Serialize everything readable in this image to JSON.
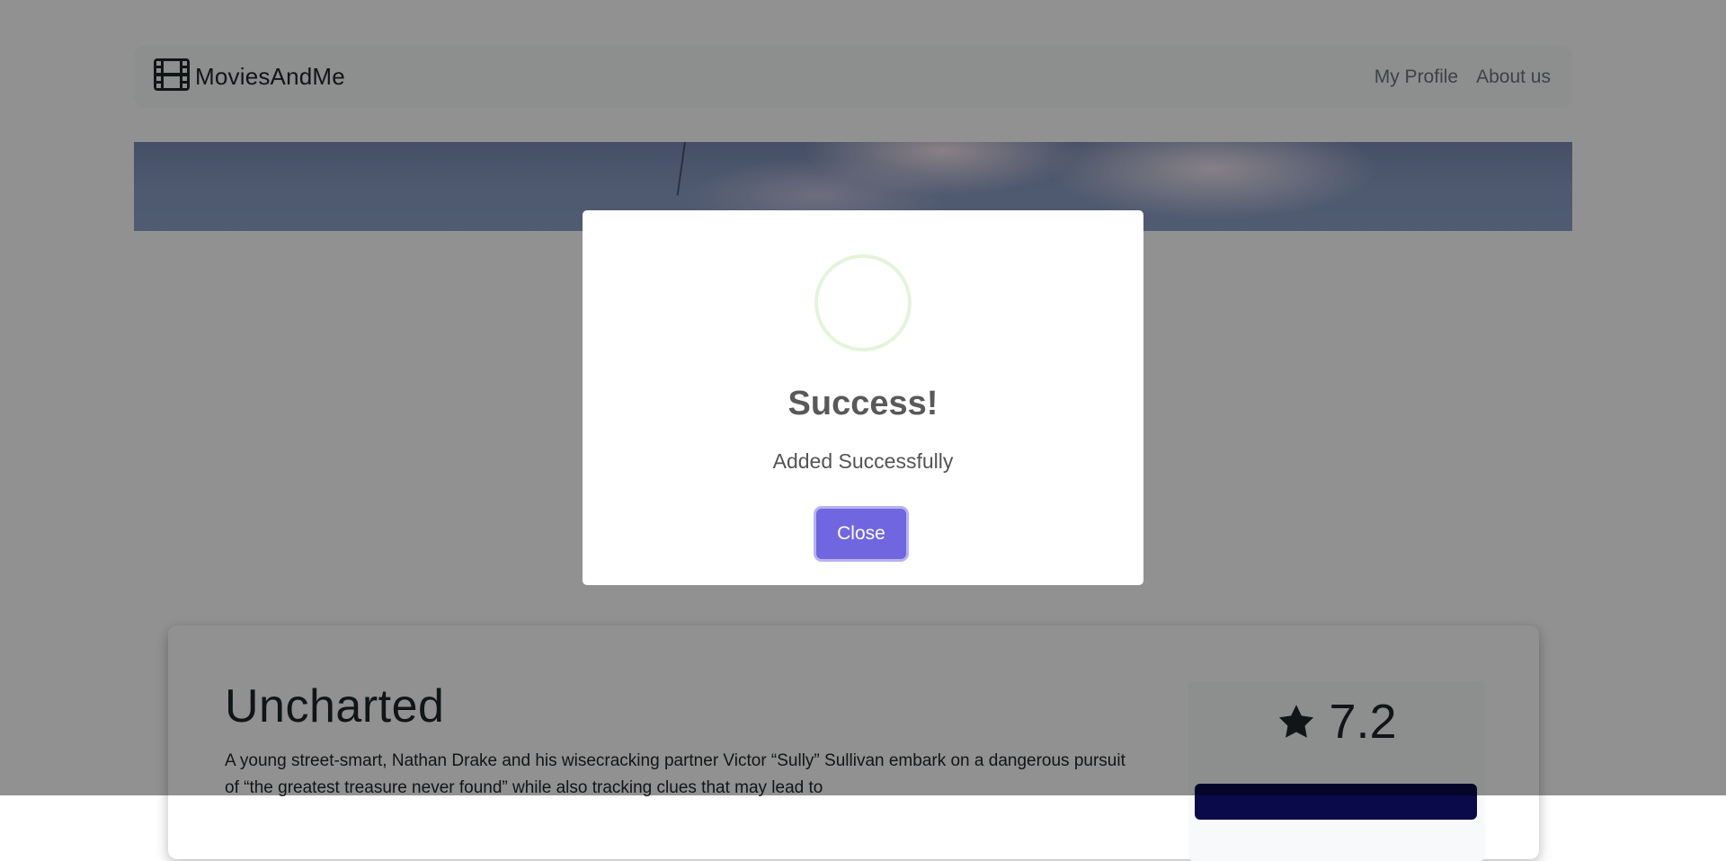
{
  "navbar": {
    "brand": "MoviesAndMe",
    "brand_icon": "film-icon",
    "links": [
      {
        "label": "My Profile"
      },
      {
        "label": "About us"
      }
    ]
  },
  "movie": {
    "title": "Uncharted",
    "description": "A young street-smart, Nathan Drake and his wisecracking partner Victor “Sully” Sullivan embark on a dangerous pursuit of “the greatest treasure never found” while also tracking clues that may lead to",
    "rating": "7.2",
    "rating_icon": "star-icon"
  },
  "modal": {
    "title": "Success!",
    "text": "Added Successfully",
    "close_label": "Close",
    "icon": "success-icon"
  },
  "colors": {
    "overlay": "rgba(0,0,0,0.43)",
    "confirm_button": "#7066e0",
    "success_ring": "#a5dc86"
  }
}
